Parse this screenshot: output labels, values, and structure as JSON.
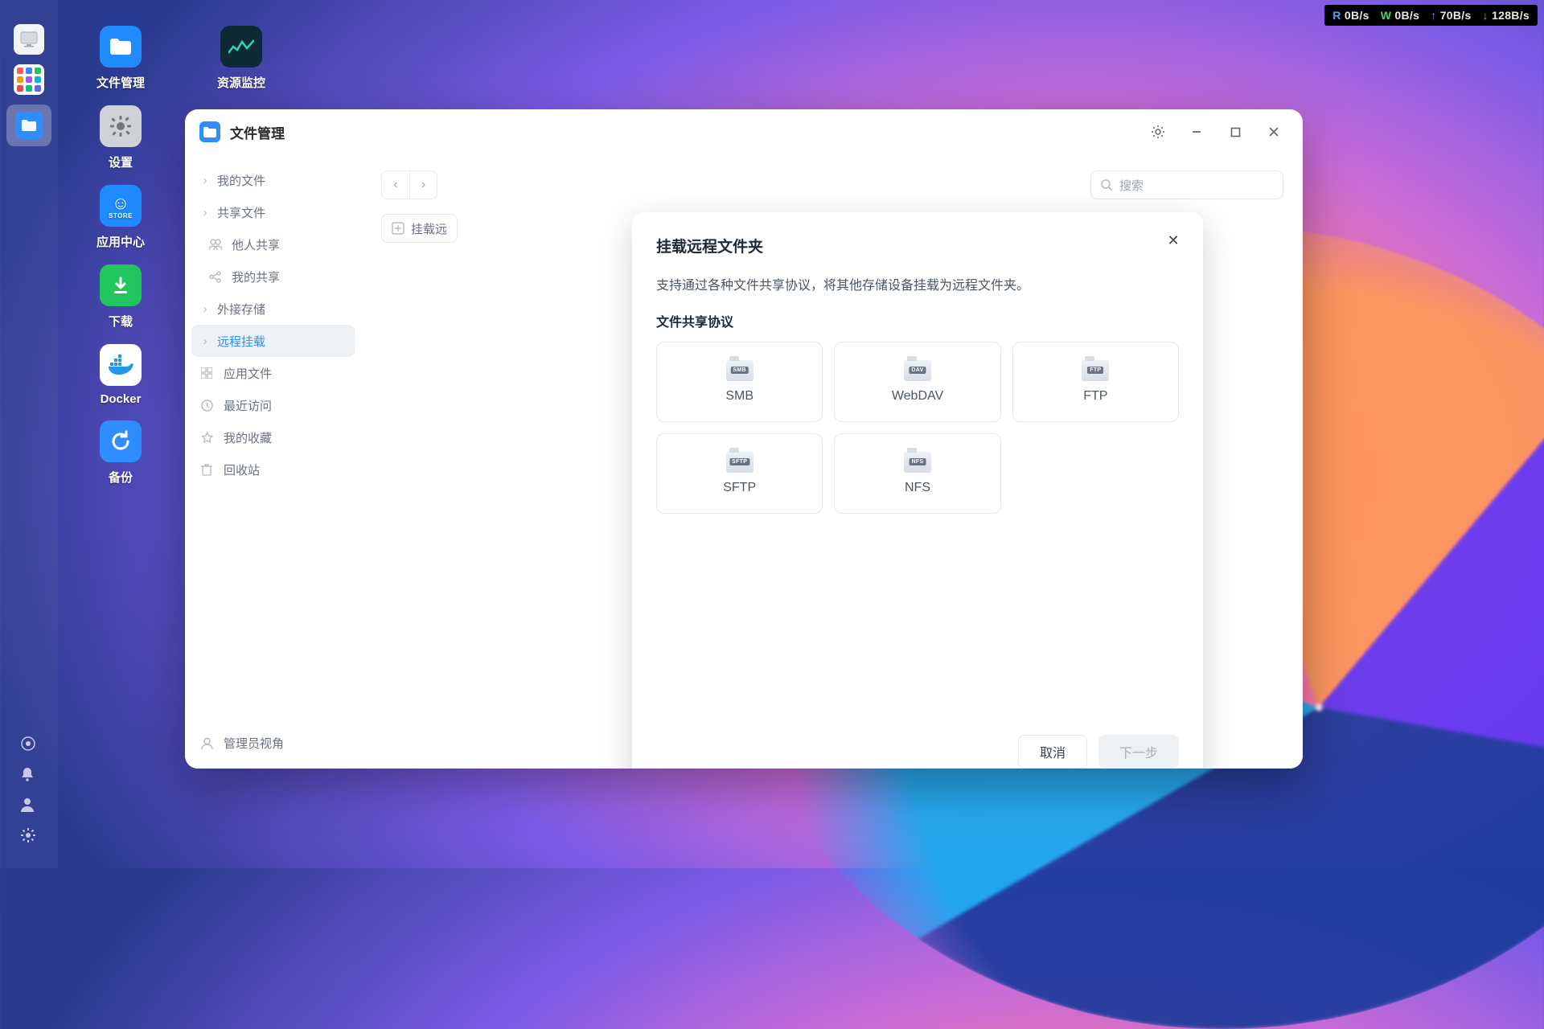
{
  "netstats": {
    "r": "0B/s",
    "w": "0B/s",
    "up": "70B/s",
    "down": "128B/s"
  },
  "dock_apps_colors": [
    "#ff5f57",
    "#3b82f6",
    "#22c55e",
    "#f59e0b",
    "#a855f7",
    "#06b6d4",
    "#ef4444",
    "#10b981",
    "#6366f1"
  ],
  "desktop": [
    {
      "id": "fm",
      "label": "文件管理"
    },
    {
      "id": "mon",
      "label": "资源监控"
    },
    {
      "id": "set",
      "label": "设置"
    },
    {
      "id": "store",
      "label": "应用中心",
      "badge": "STORE"
    },
    {
      "id": "dl",
      "label": "下载"
    },
    {
      "id": "dock",
      "label": "Docker"
    },
    {
      "id": "bak",
      "label": "备份"
    }
  ],
  "window": {
    "title": "文件管理",
    "search_placeholder": "搜索",
    "mount_chip": "挂载远",
    "sidebar": [
      {
        "label": "我的文件",
        "icon": "›",
        "kind": "root"
      },
      {
        "label": "共享文件",
        "icon": "›",
        "kind": "root"
      },
      {
        "label": "他人共享",
        "icon": "users",
        "kind": "sub"
      },
      {
        "label": "我的共享",
        "icon": "share",
        "kind": "sub"
      },
      {
        "label": "外接存储",
        "icon": "›",
        "kind": "root"
      },
      {
        "label": "远程挂载",
        "icon": "›",
        "kind": "root",
        "active": true
      },
      {
        "label": "应用文件",
        "icon": "grid",
        "kind": "util"
      },
      {
        "label": "最近访问",
        "icon": "clock",
        "kind": "util"
      },
      {
        "label": "我的收藏",
        "icon": "star",
        "kind": "util"
      },
      {
        "label": "回收站",
        "icon": "trash",
        "kind": "util"
      }
    ],
    "sidebar_footer": "管理员视角"
  },
  "modal": {
    "title": "挂载远程文件夹",
    "description": "支持通过各种文件共享协议，将其他存储设备挂载为远程文件夹。",
    "section": "文件共享协议",
    "protocols": [
      {
        "label": "SMB",
        "tag": "SMB"
      },
      {
        "label": "WebDAV",
        "tag": "DAV"
      },
      {
        "label": "FTP",
        "tag": "FTP"
      },
      {
        "label": "SFTP",
        "tag": "SFTP"
      },
      {
        "label": "NFS",
        "tag": "NFS"
      }
    ],
    "cancel": "取消",
    "next": "下一步"
  }
}
